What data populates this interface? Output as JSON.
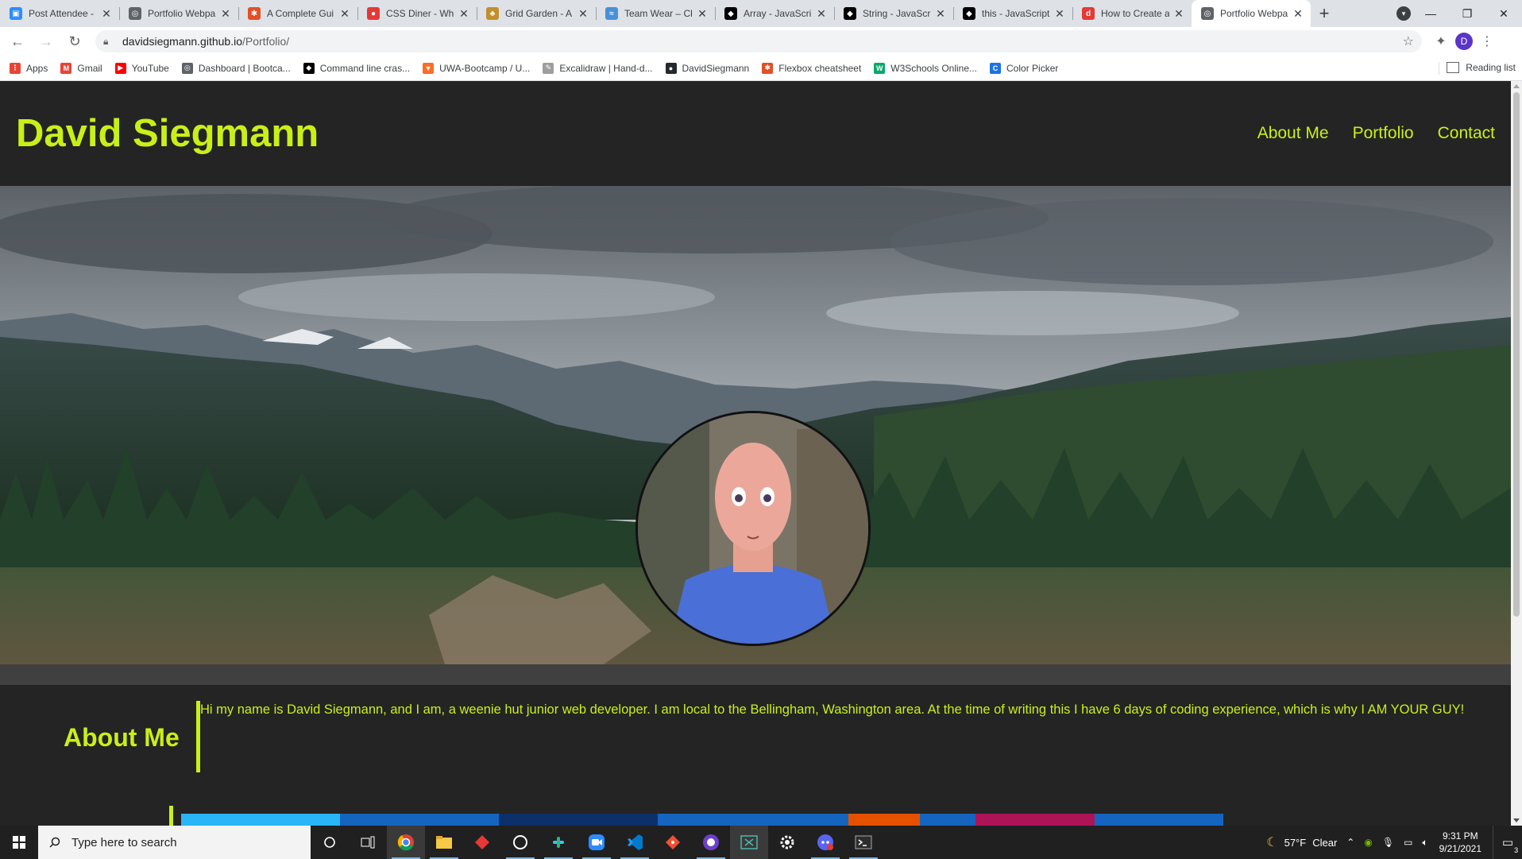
{
  "browser": {
    "tabs": [
      {
        "title": "Post Attendee -",
        "fav_color": "#2d8cff",
        "fav_glyph": "▣"
      },
      {
        "title": "Portfolio Webpa",
        "fav_color": "#5f6368",
        "fav_glyph": "◎"
      },
      {
        "title": "A Complete Gui",
        "fav_color": "#e34f26",
        "fav_glyph": "✱"
      },
      {
        "title": "CSS Diner - Whe",
        "fav_color": "#e53935",
        "fav_glyph": "●"
      },
      {
        "title": "Grid Garden - A",
        "fav_color": "#c28f2c",
        "fav_glyph": "♣"
      },
      {
        "title": "Team Wear – Cl",
        "fav_color": "#4a90d9",
        "fav_glyph": "≈"
      },
      {
        "title": "Array - JavaScrip",
        "fav_color": "#000000",
        "fav_glyph": "◆"
      },
      {
        "title": "String - JavaScri",
        "fav_color": "#000000",
        "fav_glyph": "◆"
      },
      {
        "title": "this - JavaScript",
        "fav_color": "#000000",
        "fav_glyph": "◆"
      },
      {
        "title": "How to Create a",
        "fav_color": "#e53935",
        "fav_glyph": "d"
      },
      {
        "title": "Portfolio Webpa",
        "fav_color": "#5f6368",
        "fav_glyph": "◎",
        "active": true
      }
    ],
    "new_tab_glyph": "+",
    "url_host": "davidsiegmann.github.io",
    "url_path": "/Portfolio/",
    "profile_initial": "D",
    "bookmarks": [
      {
        "label": "Apps",
        "color": "#ea4335",
        "glyph": "⋮"
      },
      {
        "label": "Gmail",
        "color": "#ea4335",
        "glyph": "M"
      },
      {
        "label": "YouTube",
        "color": "#ff0000",
        "glyph": "▶"
      },
      {
        "label": "Dashboard | Bootca...",
        "color": "#5f6368",
        "glyph": "◎"
      },
      {
        "label": "Command line cras...",
        "color": "#000000",
        "glyph": "◆"
      },
      {
        "label": "UWA-Bootcamp / U...",
        "color": "#fc6d26",
        "glyph": "▼"
      },
      {
        "label": "Excalidraw | Hand-d...",
        "color": "#9e9e9e",
        "glyph": "✎"
      },
      {
        "label": "DavidSiegmann",
        "color": "#24292e",
        "glyph": "●"
      },
      {
        "label": "Flexbox cheatsheet",
        "color": "#e34f26",
        "glyph": "✱"
      },
      {
        "label": "W3Schools Online...",
        "color": "#04aa6d",
        "glyph": "W"
      },
      {
        "label": "Color Picker",
        "color": "#1a73e8",
        "glyph": "C"
      }
    ],
    "reading_list": "Reading list"
  },
  "site": {
    "title": "David Siegmann",
    "nav": [
      "About Me",
      "Portfolio",
      "Contact"
    ],
    "accent": "#c8f018",
    "background": "#242424",
    "about_heading": "About Me",
    "about_text": "Hi my name is David Siegmann, and I am, a weenie hut junior web developer. I am local to the Bellingham, Washington area. At the time of writing this I have 6 days of coding experience, which is why I AM YOUR GUY!"
  },
  "taskbar": {
    "search_placeholder": "Type here to search",
    "weather_temp": "57°F",
    "weather_desc": "Clear",
    "time": "9:31 PM",
    "date": "9/21/2021",
    "notification_count": "3",
    "apps": [
      "task-view",
      "chrome",
      "file-explorer",
      "app-red",
      "app-github-desktop",
      "slack",
      "zoom",
      "vscode",
      "git",
      "github",
      "excel-alt",
      "settings",
      "discord",
      "terminal"
    ]
  }
}
